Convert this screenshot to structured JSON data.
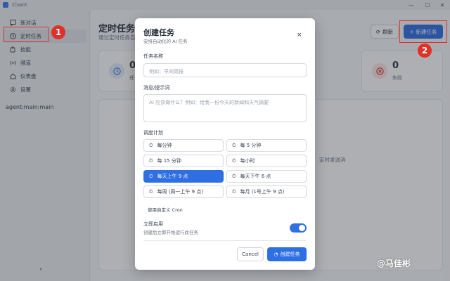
{
  "window": {
    "title": "ClawX",
    "min": "—",
    "max": "☐",
    "close": "✕"
  },
  "sidebar": {
    "items": [
      {
        "label": "新对话",
        "icon": "chat-icon"
      },
      {
        "label": "定时任务",
        "icon": "clock-icon"
      },
      {
        "label": "技能",
        "icon": "puzzle-icon"
      },
      {
        "label": "频道",
        "icon": "channel-icon"
      },
      {
        "label": "仪表盘",
        "icon": "home-icon"
      },
      {
        "label": "设置",
        "icon": "gear-icon"
      }
    ],
    "agent": "agent:main:main",
    "collapse": "‹"
  },
  "page": {
    "title": "定时任务",
    "subtitle": "通过定时任务自",
    "refresh": "刷新",
    "new_task": "+ 新建任务",
    "stats": [
      {
        "value": "0",
        "label": "任",
        "icon": "clock-icon"
      },
      {
        "value": "0",
        "label": "失败",
        "icon": "x-circle-icon"
      }
    ],
    "empty_text": "定时发送消"
  },
  "annotations": {
    "one": "1",
    "two": "2"
  },
  "modal": {
    "title": "创建任务",
    "subtitle": "安排自动化的 AI 任务",
    "close": "×",
    "name_label": "任务名称",
    "name_placeholder": "例如：早间简报",
    "prompt_label": "消息/提示词",
    "prompt_placeholder": "AI 应该做什么？例如：给我一份今天的新闻和天气摘要",
    "schedule_label": "调度计划",
    "schedules": [
      "每分钟",
      "每 5 分钟",
      "每 15 分钟",
      "每小时",
      "每天上午 9 点",
      "每天下午 6 点",
      "每周 (周一上午 9 点)",
      "每月 (1号上午 9 点)"
    ],
    "selected_schedule": "每天上午 9 点",
    "custom_cron": "使用自定义 Cron",
    "enable_label": "立即启用",
    "enable_desc": "创建后立即开始运行此任务",
    "enabled": true,
    "cancel": "Cancel",
    "create": "创建任务"
  },
  "watermark": "@马佳彬",
  "colors": {
    "accent": "#2f6fe4",
    "annotation": "#e0302a"
  }
}
